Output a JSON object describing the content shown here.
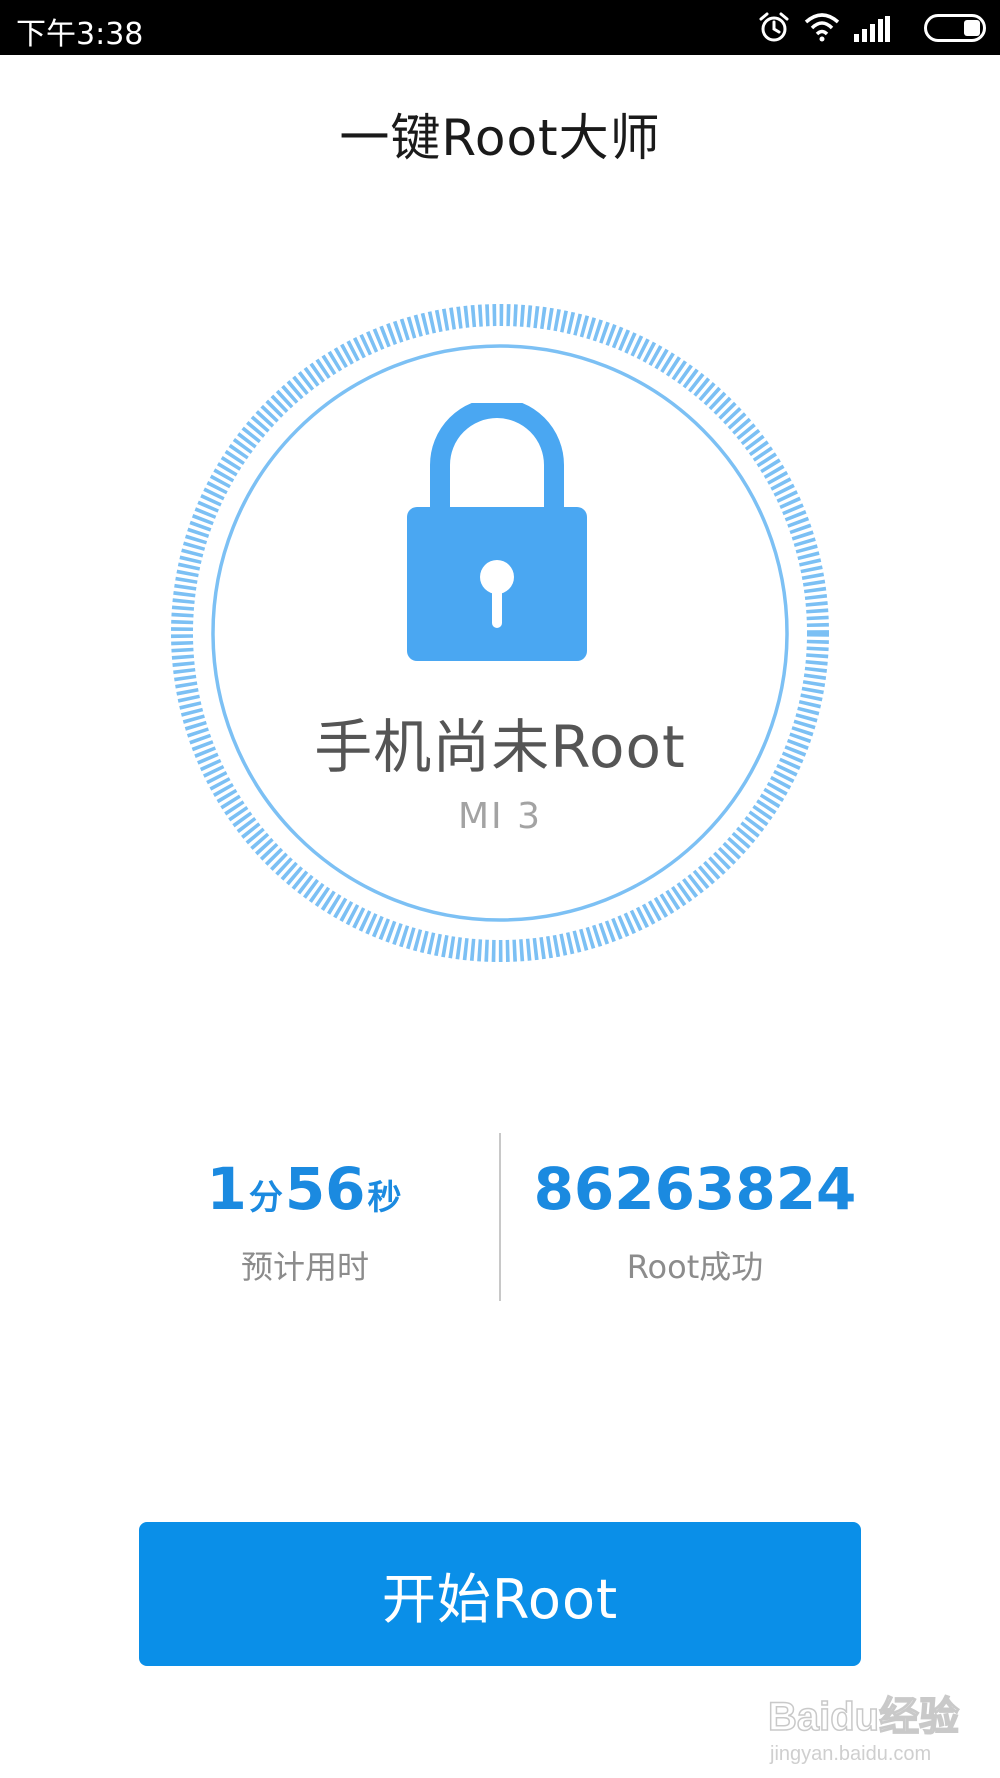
{
  "status_bar": {
    "time": "下午3:38",
    "icons": [
      "alarm-icon",
      "wifi-icon",
      "signal-icon",
      "battery-icon"
    ]
  },
  "app": {
    "title": "一键Root大师"
  },
  "device": {
    "root_status": "手机尚未Root",
    "model": "MI 3"
  },
  "stats": {
    "estimated_time": {
      "minutes": "1",
      "minutes_unit": "分",
      "seconds": "56",
      "seconds_unit": "秒",
      "label": "预计用时"
    },
    "root_success": {
      "value": "86263824",
      "label": "Root成功"
    }
  },
  "actions": {
    "start_label": "开始Root"
  },
  "watermark": {
    "brand": "Baidu经验",
    "url": "jingyan.baidu.com"
  },
  "colors": {
    "accent": "#0a8fe8",
    "lock": "#4aa7f2",
    "ring": "#7cc0f4"
  }
}
